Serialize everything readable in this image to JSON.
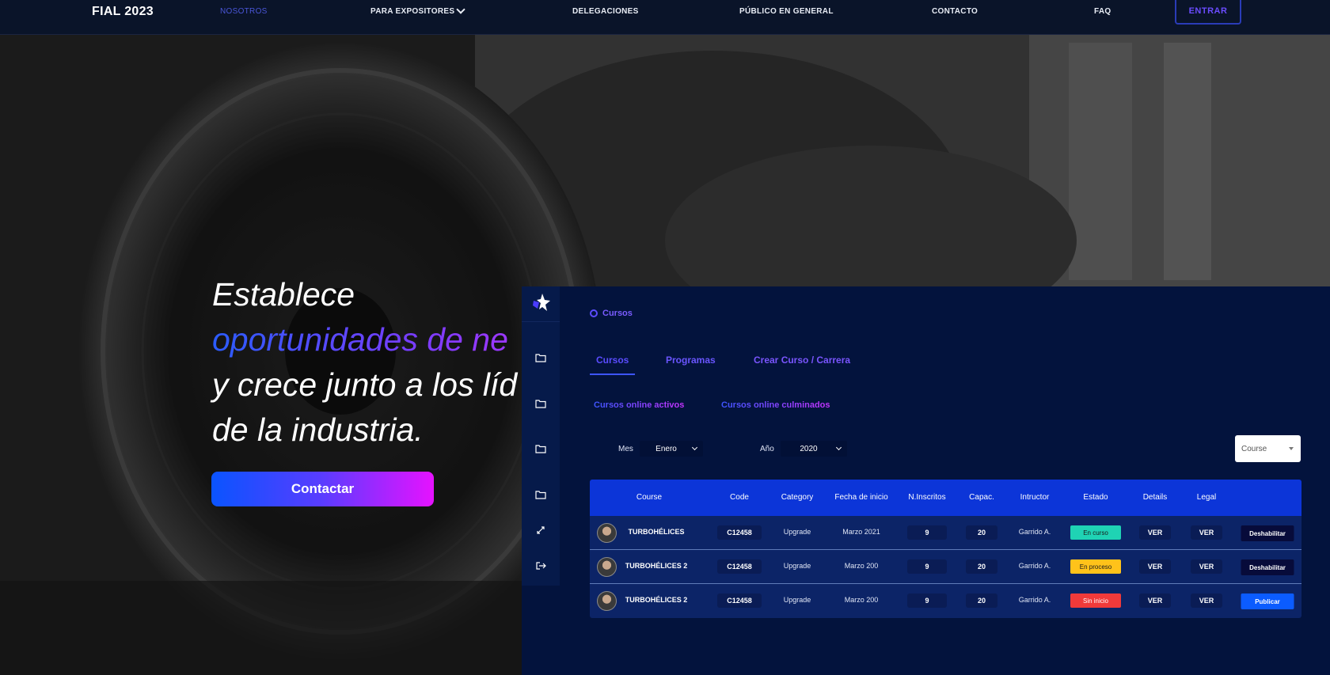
{
  "topnav": {
    "brand": "FIAL 2023",
    "links": [
      "NOSOTROS",
      "PARA EXPOSITORES",
      "DELEGACIONES",
      "PÚBLICO EN GENERAL",
      "CONTACTO",
      "FAQ"
    ],
    "enter_label": "ENTRAR"
  },
  "hero": {
    "line1": "Establece",
    "line2": "oportunidades de ne",
    "line3": "y crece junto a los líd",
    "line4": "de la industria.",
    "cta": "Contactar"
  },
  "dashboard": {
    "breadcrumb": "Cursos",
    "tabs": [
      "Cursos",
      "Programas",
      "Crear Curso / Carrera"
    ],
    "subtabs": [
      "Cursos online activos",
      "Cursos online culminados"
    ],
    "filters": {
      "mes_label": "Mes",
      "mes_value": "Enero",
      "anio_label": "Año",
      "anio_value": "2020",
      "course_value": "Course"
    },
    "table": {
      "headers": [
        "Course",
        "Code",
        "Category",
        "Fecha de inicio",
        "N.Inscritos",
        "Capac.",
        "Intructor",
        "Estado",
        "Details",
        "Legal"
      ],
      "rows": [
        {
          "course": "TURBOHÉLICES",
          "code": "C12458",
          "category": "Upgrade",
          "fecha": "Marzo 2021",
          "inscritos": "9",
          "capac": "20",
          "instructor": "Garrido A.",
          "estado": "En curso",
          "estado_color": "#1fd3b4",
          "details": "VER",
          "legal": "VER",
          "action": "Deshabilitar",
          "action_color": "#070b3a"
        },
        {
          "course": "TURBOHÉLICES 2",
          "code": "C12458",
          "category": "Upgrade",
          "fecha": "Marzo 200",
          "inscritos": "9",
          "capac": "20",
          "instructor": "Garrido A.",
          "estado": "En proceso",
          "estado_color": "#ffc21a",
          "details": "VER",
          "legal": "VER",
          "action": "Deshabilitar",
          "action_color": "#070b3a"
        },
        {
          "course": "TURBOHÉLICES 2",
          "code": "C12458",
          "category": "Upgrade",
          "fecha": "Marzo 200",
          "inscritos": "9",
          "capac": "20",
          "instructor": "Garrido A.",
          "estado": "Sin inicio",
          "estado_color": "#f03a3a",
          "details": "VER",
          "legal": "VER",
          "action": "Publicar",
          "action_color": "#0b5cff"
        }
      ]
    }
  }
}
